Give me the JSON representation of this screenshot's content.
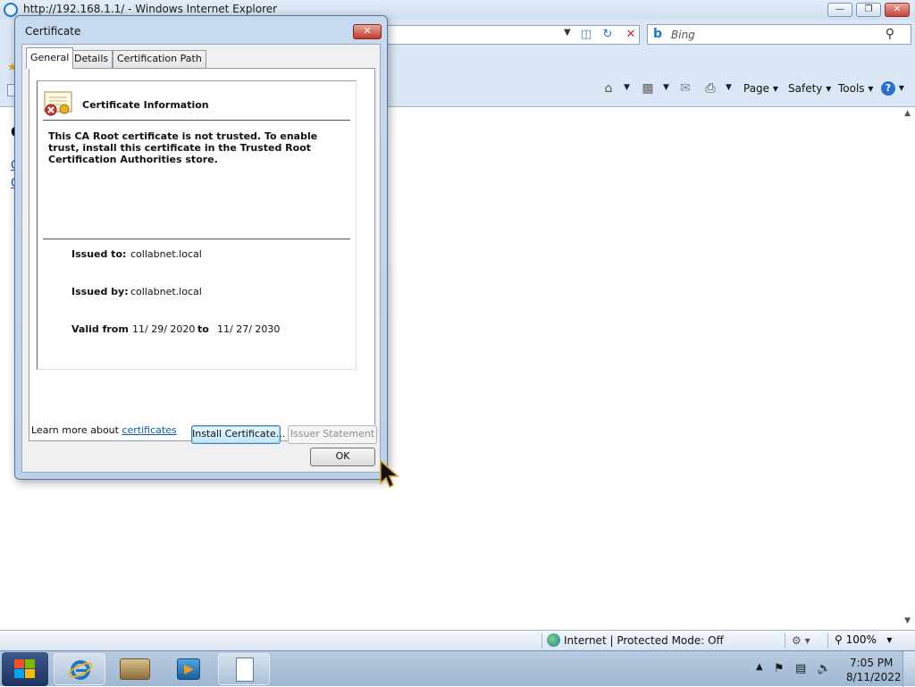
{
  "browser": {
    "title": "http://192.168.1.1/ - Windows Internet Explorer",
    "search_placeholder": "Bing",
    "command_bar": {
      "page_label": "Page",
      "safety_label": "Safety",
      "tools_label": "Tools"
    },
    "status": {
      "zone": "Internet | Protected Mode: Off",
      "zoom": "100%"
    }
  },
  "dialog": {
    "title": "Certificate",
    "tabs": [
      {
        "label": "General",
        "active": true
      },
      {
        "label": "Details",
        "active": false
      },
      {
        "label": "Certification Path",
        "active": false
      }
    ],
    "heading": "Certificate Information",
    "message": "This CA Root certificate is not trusted. To enable trust, install this certificate in the Trusted Root Certification Authorities store.",
    "issued_to_label": "Issued to:",
    "issued_to": "collabnet.local",
    "issued_by_label": "Issued by:",
    "issued_by": "collabnet.local",
    "valid_from_label": "Valid from",
    "valid_from": "11/ 29/ 2020",
    "to_label": "to",
    "valid_to": "11/ 27/ 2030",
    "install_button": "Install Certificate...",
    "issuer_button": "Issuer Statement",
    "learn_more_text": "Learn more about ",
    "learn_more_link": "certificates",
    "ok_button": "OK"
  },
  "taskbar": {
    "time": "7:05 PM",
    "date": "8/11/2022"
  },
  "colors": {
    "accent": "#1e74c9",
    "link": "#0a5db5",
    "close_red": "#c23b30"
  }
}
